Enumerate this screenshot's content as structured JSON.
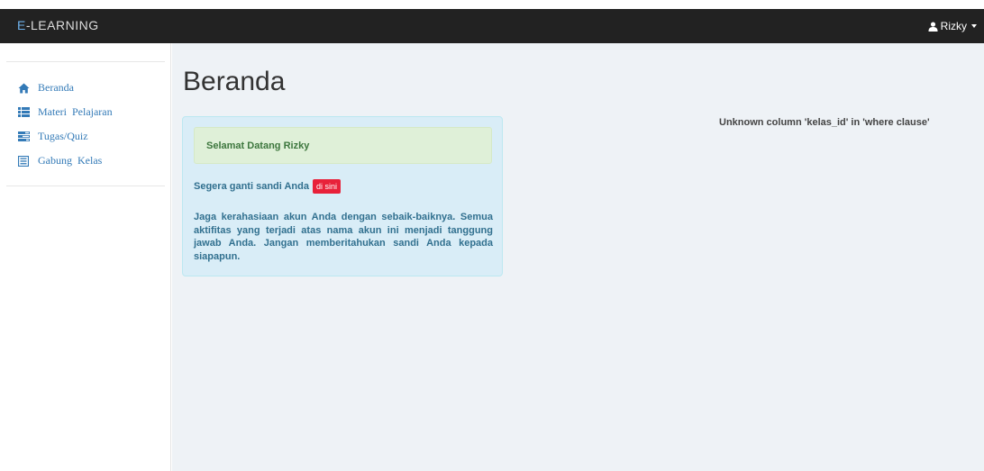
{
  "navbar": {
    "brand_accent": "E",
    "brand_rest": "-LEARNING",
    "user_name": "Rizky"
  },
  "sidebar": {
    "items": [
      {
        "label": "Beranda",
        "icon": "home-icon"
      },
      {
        "label": "Materi Pelajaran",
        "icon": "list-icon"
      },
      {
        "label": "Tugas/Quiz",
        "icon": "tasks-icon"
      },
      {
        "label": "Gabung Kelas",
        "icon": "book-icon"
      }
    ]
  },
  "main": {
    "title": "Beranda",
    "welcome": "Selamat Datang Rizky",
    "password_text": "Segera ganti sandi Anda",
    "password_link": "di sini",
    "notice": "Jaga kerahasiaan akun Anda dengan sebaik-baiknya. Semua aktifitas yang terjadi atas nama akun ini menjadi tanggung jawab Anda. Jangan memberitahukan sandi Anda kepada siapapun.",
    "error": "Unknown column 'kelas_id' in 'where clause'"
  },
  "colors": {
    "navbar_bg": "#222222",
    "brand_accent": "#6fb1ec",
    "link": "#337ab7",
    "panel_bg": "#d9edf7",
    "success_bg": "#dff0d8",
    "badge_bg": "#e8213a",
    "main_bg": "#eef2f6"
  }
}
